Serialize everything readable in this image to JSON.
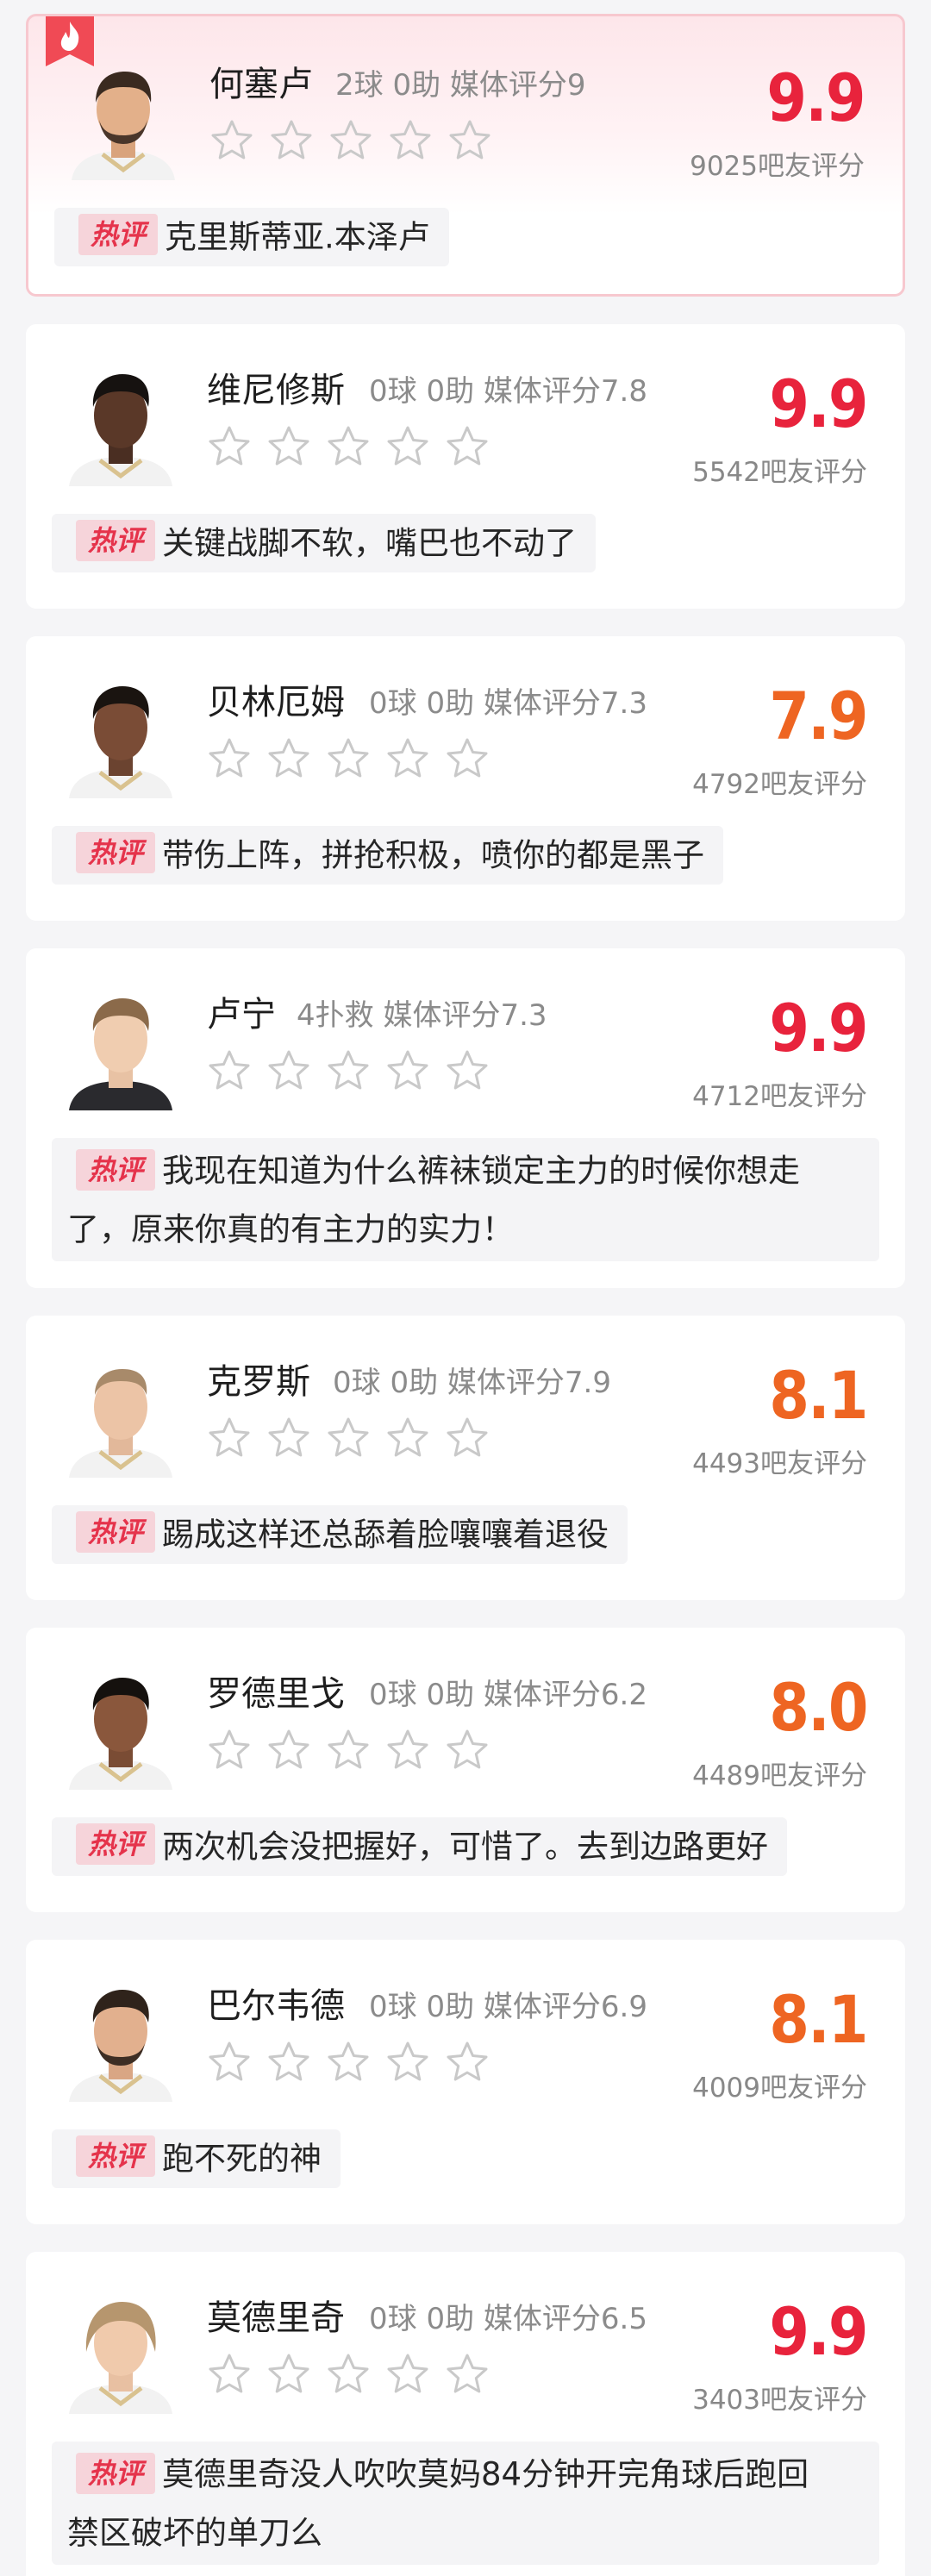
{
  "colors": {
    "score_red": "#e8233c",
    "score_orange": "#ee6522",
    "tag_bg": "#f6d4da",
    "tag_text": "#e5334b",
    "star_outline": "#c9c9c9",
    "fire_badge": "#f04a55"
  },
  "hot_tag_label": "热评",
  "players": [
    {
      "name": "何塞卢",
      "stats": "2球 0助  媒体评分9",
      "rating_stars": 0,
      "score": "9.9",
      "score_color": "red",
      "count": "9025吧友评分",
      "comment": "克里斯蒂亚.本泽卢",
      "highlighted": true,
      "avatar": "player-avatar-joselu"
    },
    {
      "name": "维尼修斯",
      "stats": "0球 0助  媒体评分7.8",
      "rating_stars": 0,
      "score": "9.9",
      "score_color": "red",
      "count": "5542吧友评分",
      "comment": "关键战脚不软，嘴巴也不动了",
      "avatar": "player-avatar-vinicius"
    },
    {
      "name": "贝林厄姆",
      "stats": "0球 0助  媒体评分7.3",
      "rating_stars": 0,
      "score": "7.9",
      "score_color": "orange",
      "count": "4792吧友评分",
      "comment": "带伤上阵，拼抢积极，喷你的都是黑子",
      "avatar": "player-avatar-bellingham"
    },
    {
      "name": "卢宁",
      "stats": "4扑救  媒体评分7.3",
      "rating_stars": 0,
      "score": "9.9",
      "score_color": "red",
      "count": "4712吧友评分",
      "comment_line1": "我现在知道为什么裤袜锁定主力的时候你想走",
      "comment_line2": "了，原来你真的有主力的实力！",
      "avatar": "player-avatar-lunin"
    },
    {
      "name": "克罗斯",
      "stats": "0球 0助  媒体评分7.9",
      "rating_stars": 0,
      "score": "8.1",
      "score_color": "orange",
      "count": "4493吧友评分",
      "comment": "踢成这样还总舔着脸嚷嚷着退役",
      "avatar": "player-avatar-kroos"
    },
    {
      "name": "罗德里戈",
      "stats": "0球 0助  媒体评分6.2",
      "rating_stars": 0,
      "score": "8.0",
      "score_color": "orange",
      "count": "4489吧友评分",
      "comment": "两次机会没把握好，可惜了。去到边路更好",
      "avatar": "player-avatar-rodrygo"
    },
    {
      "name": "巴尔韦德",
      "stats": "0球 0助  媒体评分6.9",
      "rating_stars": 0,
      "score": "8.1",
      "score_color": "orange",
      "count": "4009吧友评分",
      "comment": "跑不死的神",
      "avatar": "player-avatar-valverde"
    },
    {
      "name": "莫德里奇",
      "stats": "0球 0助  媒体评分6.5",
      "rating_stars": 0,
      "score": "9.9",
      "score_color": "red",
      "count": "3403吧友评分",
      "comment_line1": "莫德里奇没人吹吹莫妈84分钟开完角球后跑回",
      "comment_line2": "禁区破坏的单刀么",
      "avatar": "player-avatar-modric"
    }
  ]
}
